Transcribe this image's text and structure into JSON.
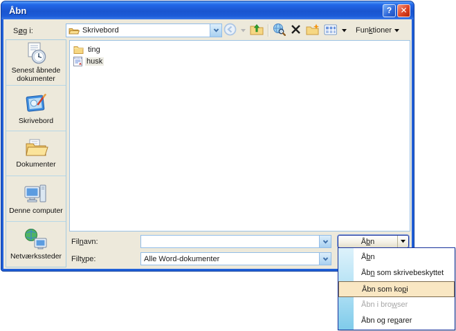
{
  "window": {
    "title": "Åbn",
    "help": "?",
    "close": "✕"
  },
  "toolbar": {
    "look_in": {
      "pre": "S",
      "accel": "ø",
      "post": "g i:"
    },
    "location": "Skrivebord",
    "tools": {
      "pre": "Fun",
      "accel": "k",
      "post": "tioner"
    },
    "icons": [
      "back",
      "up-one-level",
      "search-the-web",
      "delete",
      "create-new-folder",
      "views"
    ]
  },
  "places": [
    {
      "label": "Senest åbnede dokumenter",
      "icon": "recent-documents-icon"
    },
    {
      "label": "Skrivebord",
      "icon": "desktop-icon"
    },
    {
      "label": "Dokumenter",
      "icon": "documents-folder-icon"
    },
    {
      "label": "Denne computer",
      "icon": "my-computer-icon"
    },
    {
      "label": "Netværkssteder",
      "icon": "network-places-icon"
    }
  ],
  "file_list": [
    {
      "name": "ting",
      "type": "folder"
    },
    {
      "name": "husk",
      "type": "word-document"
    }
  ],
  "fields": {
    "filename_label": {
      "pre": "Fil",
      "accel": "n",
      "post": "avn:"
    },
    "filename_value": "",
    "filetype_label": {
      "pre": "Filt",
      "accel": "y",
      "post": "pe:"
    },
    "filetype_value": "Alle Word-dokumenter"
  },
  "open_button": {
    "pre": "Å",
    "accel": "b",
    "post": "n"
  },
  "menu": {
    "items": [
      {
        "pre": "Å",
        "accel": "b",
        "post": "n",
        "state": "normal"
      },
      {
        "pre": "Åb",
        "accel": "n",
        "post": " som skrivebeskyttet",
        "state": "normal"
      },
      {
        "pre": "Åbn som ko",
        "accel": "p",
        "post": "i",
        "state": "highlighted"
      },
      {
        "pre": "Åbn i bro",
        "accel": "w",
        "post": "ser",
        "state": "disabled"
      },
      {
        "pre": "Åbn og re",
        "accel": "p",
        "post": "arer",
        "state": "normal"
      }
    ]
  },
  "colors": {
    "titlebar_blue": "#2263D5",
    "dialog_bg": "#EDE9DB",
    "menu_highlight_bg": "#F9E7C3",
    "menu_highlight_border": "#7C6A4D",
    "menu_strip_blue": "#7FCBEA",
    "close_red": "#C22804"
  }
}
